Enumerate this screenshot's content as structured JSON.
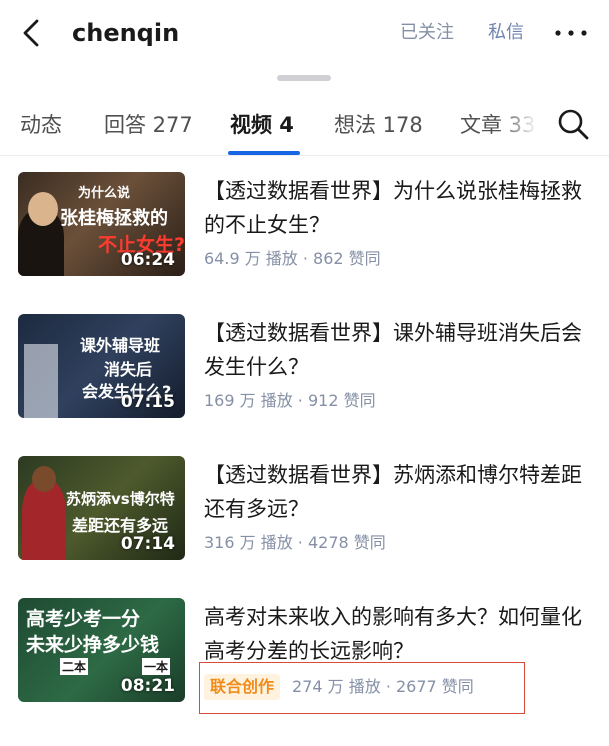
{
  "header": {
    "title": "chenqin",
    "follow_label": "已关注",
    "message_label": "私信"
  },
  "tabs": [
    {
      "label": "动态"
    },
    {
      "label": "回答 277"
    },
    {
      "label": "视频 4"
    },
    {
      "label": "想法 178"
    },
    {
      "label": "文章 33"
    }
  ],
  "videos": [
    {
      "title": "【透过数据看世界】为什么说张桂梅拯救的不止女生？",
      "meta": "64.9 万 播放 · 862 赞同",
      "duration": "06:24",
      "thumb_text": [
        "为什么说",
        "张桂梅拯救的",
        "不止女生?"
      ]
    },
    {
      "title": "【透过数据看世界】课外辅导班消失后会发生什么？",
      "meta": "169 万 播放 · 912 赞同",
      "duration": "07:15",
      "thumb_text": [
        "课外辅导班",
        "消失后",
        "会发生什么?"
      ]
    },
    {
      "title": "【透过数据看世界】苏炳添和博尔特差距还有多远？",
      "meta": "316 万 播放 · 4278 赞同",
      "duration": "07:14",
      "thumb_text": [
        "苏炳添vs博尔特",
        "差距还有多远"
      ]
    },
    {
      "title": "高考对未来收入的影响有多大？如何量化高考分差的长远影响？",
      "meta": "274 万 播放 · 2677 赞同",
      "duration": "08:21",
      "badge": "联合创作",
      "thumb_text": [
        "高考少考一分",
        "未来少挣多少钱",
        "二本",
        "一本"
      ]
    }
  ],
  "colors": {
    "accent": "#1766e6",
    "meta_gray": "#8590a6",
    "badge_orange": "#f08c1c",
    "highlight_red": "#d94a3a"
  },
  "icons": [
    "back-arrow-icon",
    "more-dots-icon",
    "search-icon"
  ]
}
